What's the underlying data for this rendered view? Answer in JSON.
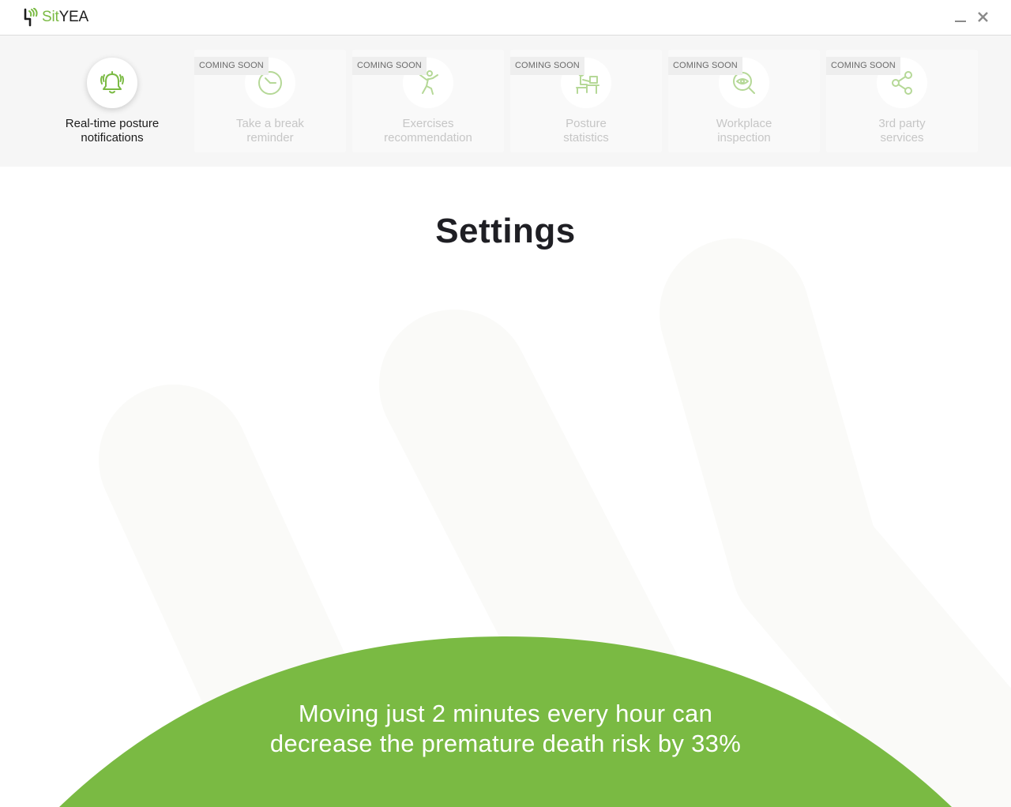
{
  "app": {
    "logo_part1": "Sit",
    "logo_part2": "YEA",
    "accent_color": "#7aba43"
  },
  "window_controls": {
    "minimize_icon": "minimize-icon",
    "close_icon": "close-icon"
  },
  "features": [
    {
      "line1": "Real-time posture",
      "line2": "notifications",
      "icon": "bell-icon",
      "active": true,
      "badge": ""
    },
    {
      "line1": "Take a break",
      "line2": "reminder",
      "icon": "clock-icon",
      "active": false,
      "badge": "COMING SOON"
    },
    {
      "line1": "Exercises",
      "line2": "recommendation",
      "icon": "exercise-icon",
      "active": false,
      "badge": "COMING SOON"
    },
    {
      "line1": "Posture",
      "line2": "statistics",
      "icon": "desk-posture-icon",
      "active": false,
      "badge": "COMING SOON"
    },
    {
      "line1": "Workplace",
      "line2": "inspection",
      "icon": "magnifier-eye-icon",
      "active": false,
      "badge": "COMING SOON"
    },
    {
      "line1": "3rd party",
      "line2": "services",
      "icon": "share-icon",
      "active": false,
      "badge": "COMING SOON"
    }
  ],
  "main": {
    "title": "Settings"
  },
  "tip": {
    "line1": "Moving just 2 minutes every hour can",
    "line2": "decrease the premature death risk by 33%",
    "background_color": "#7aba43"
  }
}
